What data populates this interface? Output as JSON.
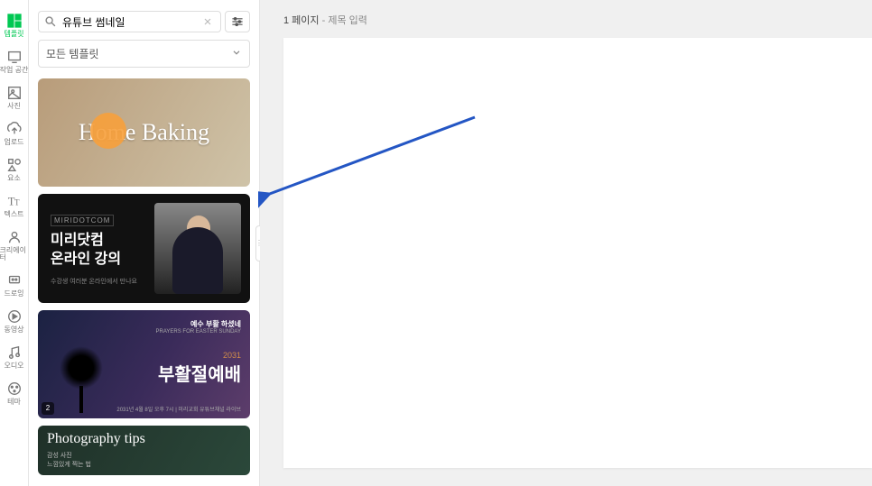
{
  "rail": {
    "items": [
      {
        "label": "템플릿",
        "icon": "template-icon"
      },
      {
        "label": "작업 공간",
        "icon": "workspace-icon"
      },
      {
        "label": "사진",
        "icon": "photo-icon"
      },
      {
        "label": "업로드",
        "icon": "upload-icon"
      },
      {
        "label": "요소",
        "icon": "elements-icon"
      },
      {
        "label": "텍스트",
        "icon": "text-icon"
      },
      {
        "label": "크리에이터",
        "icon": "creator-icon"
      },
      {
        "label": "드로잉",
        "icon": "drawing-icon"
      },
      {
        "label": "동영상",
        "icon": "video-icon"
      },
      {
        "label": "오디오",
        "icon": "audio-icon"
      },
      {
        "label": "테마",
        "icon": "theme-icon"
      }
    ]
  },
  "search": {
    "value": "유튜브 썸네일",
    "placeholder": "유튜브 썸네일"
  },
  "filter_dropdown": {
    "label": "모든 템플릿"
  },
  "templates": [
    {
      "title": "Home Baking",
      "kind": "baking"
    },
    {
      "brand": "MIRIDOTCOM",
      "title_line1": "미리닷컴",
      "title_line2": "온라인 강의",
      "subtitle": "수강생 여러분 온라인에서 만나요",
      "kind": "lecture"
    },
    {
      "top_small": "예수 부활 하셨네",
      "top_sub": "PRAYERS FOR EASTER SUNDAY",
      "year": "2031",
      "main": "부활절예배",
      "bottom": "2031년 4월 8일 오후 7시  |  미리교회 유튜브채널 라이브",
      "badge": "2",
      "kind": "easter"
    },
    {
      "title": "Photography tips",
      "sub_line1": "감성 사진",
      "sub_line2": "느낌있게 찍는 법",
      "kind": "photo"
    }
  ],
  "canvas": {
    "page_number": "1 페이지",
    "title_placeholder": "제목 입력"
  }
}
